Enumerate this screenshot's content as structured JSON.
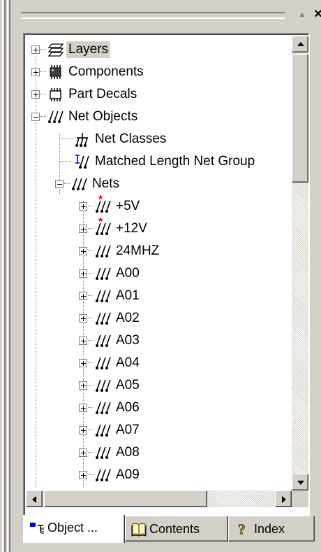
{
  "panel": {
    "close_label": "×",
    "up_label": "▲"
  },
  "tree": {
    "layers": "Layers",
    "components": "Components",
    "part_decals": "Part Decals",
    "net_objects": "Net Objects",
    "net_classes": "Net Classes",
    "matched_length": "Matched Length Net Group",
    "nets": "Nets",
    "net_items": [
      "+5V",
      "+12V",
      "24MHZ",
      "A00",
      "A01",
      "A02",
      "A03",
      "A04",
      "A05",
      "A06",
      "A07",
      "A08",
      "A09"
    ]
  },
  "tabs": {
    "object": "Object ...",
    "contents": "Contents",
    "index": "Index"
  },
  "icons": {
    "layers": "layers-icon",
    "components": "components-icon",
    "part_decals": "part-decals-icon",
    "net": "net-icon",
    "net_classes": "net-classes-icon",
    "matched_length": "matched-length-icon",
    "power_net": "power-net-icon"
  },
  "colors": {
    "selection_bg": "#d4d0c8",
    "power_marker": "#e00000",
    "matched_marker": "#0000e0"
  }
}
